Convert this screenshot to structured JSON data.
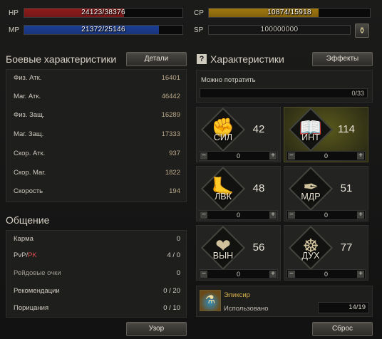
{
  "vitals": {
    "hp": {
      "label": "HP",
      "value": "24123/38376",
      "fraction": 0.629,
      "color": "#8e1c1c"
    },
    "mp": {
      "label": "MP",
      "value": "21372/25146",
      "fraction": 0.85,
      "color": "#1c3f96"
    },
    "cp": {
      "label": "CP",
      "value": "10874/15918",
      "fraction": 0.683,
      "color": "#a0780f"
    },
    "sp": {
      "label": "SP",
      "value": "100000000"
    }
  },
  "combat": {
    "title": "Боевые характеристики",
    "details_button": "Детали",
    "rows": [
      {
        "label": "Физ. Атк.",
        "value": "16401"
      },
      {
        "label": "Маг. Атк.",
        "value": "46442"
      },
      {
        "label": "Физ. Защ.",
        "value": "16289"
      },
      {
        "label": "Маг. Защ.",
        "value": "17333"
      },
      {
        "label": "Скор. Атк.",
        "value": "937"
      },
      {
        "label": "Скор. Маг.",
        "value": "1822"
      },
      {
        "label": "Скорость",
        "value": "194"
      }
    ]
  },
  "social": {
    "title": "Общение",
    "karma": {
      "label": "Карма",
      "value": "0"
    },
    "pvp": {
      "label_pvp": "PvP",
      "slash": "/",
      "label_pk": "PK",
      "value": "4 / 0"
    },
    "raid": {
      "label": "Рейдовые очки",
      "value": "0"
    },
    "recommend": {
      "label": "Рекомендации",
      "value": "0 / 20"
    },
    "censure": {
      "label": "Порицания",
      "value": "0 / 10"
    },
    "pattern_button": "Узор"
  },
  "stats": {
    "help_icon": "?",
    "title": "Характеристики",
    "effects_button": "Эффекты",
    "available_label": "Можно потратить",
    "available_value": "0/33",
    "tiles": [
      {
        "name": "СИЛ",
        "value": "42",
        "alloc": "0",
        "icon": "arm-icon",
        "glyph": "✊",
        "highlight": false
      },
      {
        "name": "ИНТ",
        "value": "114",
        "alloc": "0",
        "icon": "book-icon",
        "glyph": "📖",
        "highlight": true
      },
      {
        "name": "ЛВК",
        "value": "48",
        "alloc": "0",
        "icon": "foot-icon",
        "glyph": "🦶",
        "highlight": false
      },
      {
        "name": "МДР",
        "value": "51",
        "alloc": "0",
        "icon": "feather-icon",
        "glyph": "✒",
        "highlight": false
      },
      {
        "name": "ВЫН",
        "value": "56",
        "alloc": "0",
        "icon": "heart-icon",
        "glyph": "❤",
        "highlight": false
      },
      {
        "name": "ДУХ",
        "value": "77",
        "alloc": "0",
        "icon": "mind-icon",
        "glyph": "☸",
        "highlight": false
      }
    ],
    "minus": "−",
    "plus": "+",
    "elixir": {
      "title": "Эликсир",
      "used_label": "Использовано",
      "used_value": "14/19"
    },
    "reset_button": "Сброс"
  }
}
